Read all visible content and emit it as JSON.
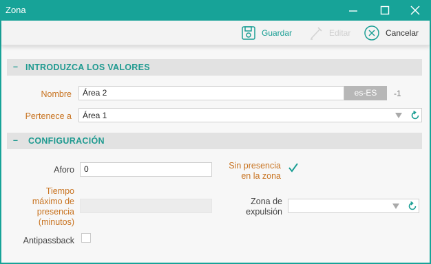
{
  "window": {
    "title": "Zona"
  },
  "toolbar": {
    "save_label": "Guardar",
    "edit_label": "Editar",
    "cancel_label": "Cancelar"
  },
  "sections": {
    "values_title": "INTRODUZCA LOS VALORES",
    "config_title": "CONFIGURACIÓN",
    "collapse_symbol": "–"
  },
  "fields": {
    "nombre": {
      "label": "Nombre",
      "value": "Área 2",
      "lang": "es-ES",
      "suffix": "-1"
    },
    "pertenece": {
      "label": "Pertenece a",
      "value": "Área 1"
    },
    "aforo": {
      "label": "Aforo",
      "value": "0"
    },
    "sin_presencia": {
      "label_line1": "Sin presencia",
      "label_line2": "en la zona",
      "checked": true
    },
    "tiempo": {
      "label_line1": "Tiempo",
      "label_line2": "máximo de",
      "label_line3": "presencia",
      "label_line4": "(minutos)",
      "value": ""
    },
    "zona_expulsion": {
      "label_line1": "Zona de",
      "label_line2": "expulsión",
      "value": ""
    },
    "antipassback": {
      "label": "Antipassback",
      "checked": false
    }
  },
  "colors": {
    "accent": "#17a398",
    "label_orange": "#c87320",
    "section_bg": "#e2e2e2"
  },
  "icons": [
    "minimize-icon",
    "maximize-icon",
    "close-icon",
    "save-icon",
    "edit-icon",
    "cancel-icon",
    "dropdown-arrow-icon",
    "refresh-icon",
    "checkmark-icon"
  ]
}
